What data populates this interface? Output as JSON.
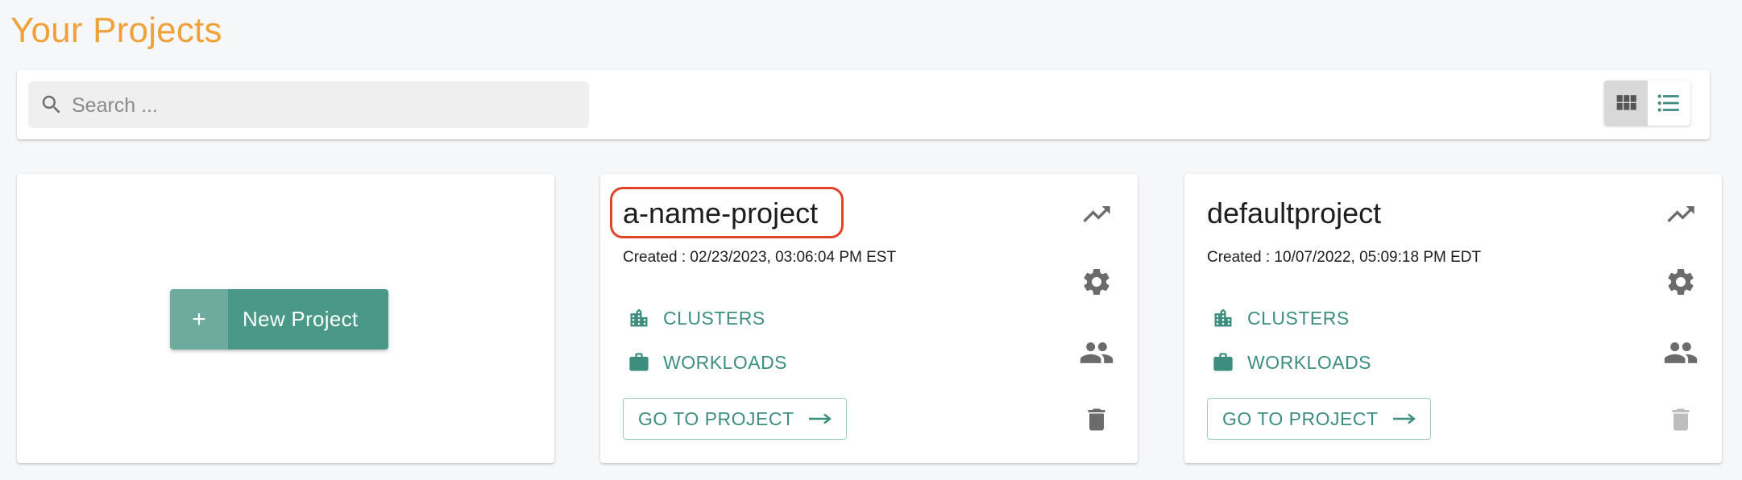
{
  "page": {
    "title": "Your Projects"
  },
  "search": {
    "placeholder": "Search ..."
  },
  "view_toggle": {
    "active": "grid"
  },
  "new_project": {
    "plus": "+",
    "label": "New Project"
  },
  "projects": [
    {
      "name": "a-name-project",
      "highlighted": true,
      "created": "Created :  02/23/2023, 03:06:04 PM EST",
      "clusters_label": "CLUSTERS",
      "workloads_label": "WORKLOADS",
      "go_label": "GO TO PROJECT",
      "delete_enabled": true
    },
    {
      "name": "defaultproject",
      "highlighted": false,
      "created": "Created :  10/07/2022, 05:09:18 PM EDT",
      "clusters_label": "CLUSTERS",
      "workloads_label": "WORKLOADS",
      "go_label": "GO TO PROJECT",
      "delete_enabled": false
    }
  ],
  "colors": {
    "title": "#f0a13c",
    "accent": "#3d8e7e",
    "button": "#4a9887",
    "highlight": "#e0452a",
    "icon": "#6b6b6b",
    "icon_disabled": "#bdbdbd"
  }
}
